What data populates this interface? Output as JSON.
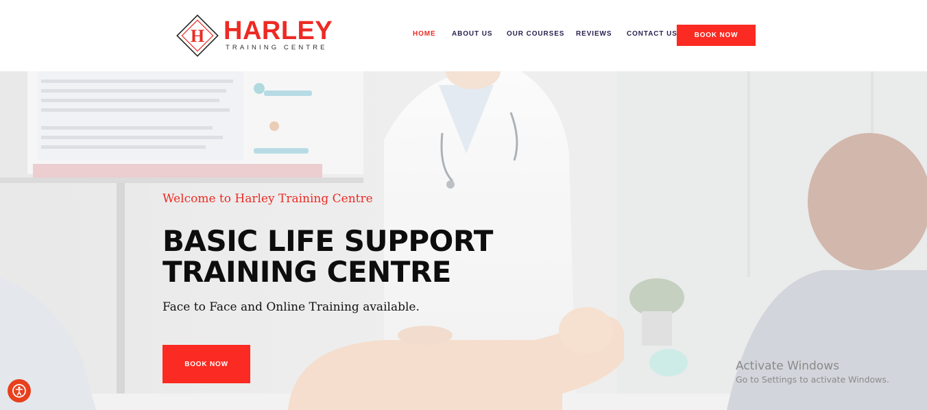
{
  "brand": {
    "logo_letter": "H",
    "name": "HARLEY",
    "tagline": "TRAINING CENTRE"
  },
  "nav": {
    "items": [
      {
        "label": "HOME",
        "active": true
      },
      {
        "label": "ABOUT US",
        "active": false
      },
      {
        "label": "OUR COURSES",
        "active": false
      },
      {
        "label": "REVIEWS",
        "active": false
      },
      {
        "label": "CONTACT US",
        "active": false
      }
    ],
    "cta_label": "BOOK NOW"
  },
  "hero": {
    "welcome": "Welcome to Harley Training Centre",
    "title_line1": "BASIC LIFE SUPPORT",
    "title_line2": "TRAINING CENTRE",
    "subtitle": "Face to Face and Online Training available.",
    "cta_label": "BOOK NOW"
  },
  "watermark": {
    "title": "Activate Windows",
    "subtitle": "Go to Settings to activate Windows."
  },
  "icons": {
    "accessibility": "accessibility-icon"
  },
  "colors": {
    "accent": "#fb2a22",
    "nav_text": "#2a1f4d",
    "heading": "#0d0d0d"
  }
}
